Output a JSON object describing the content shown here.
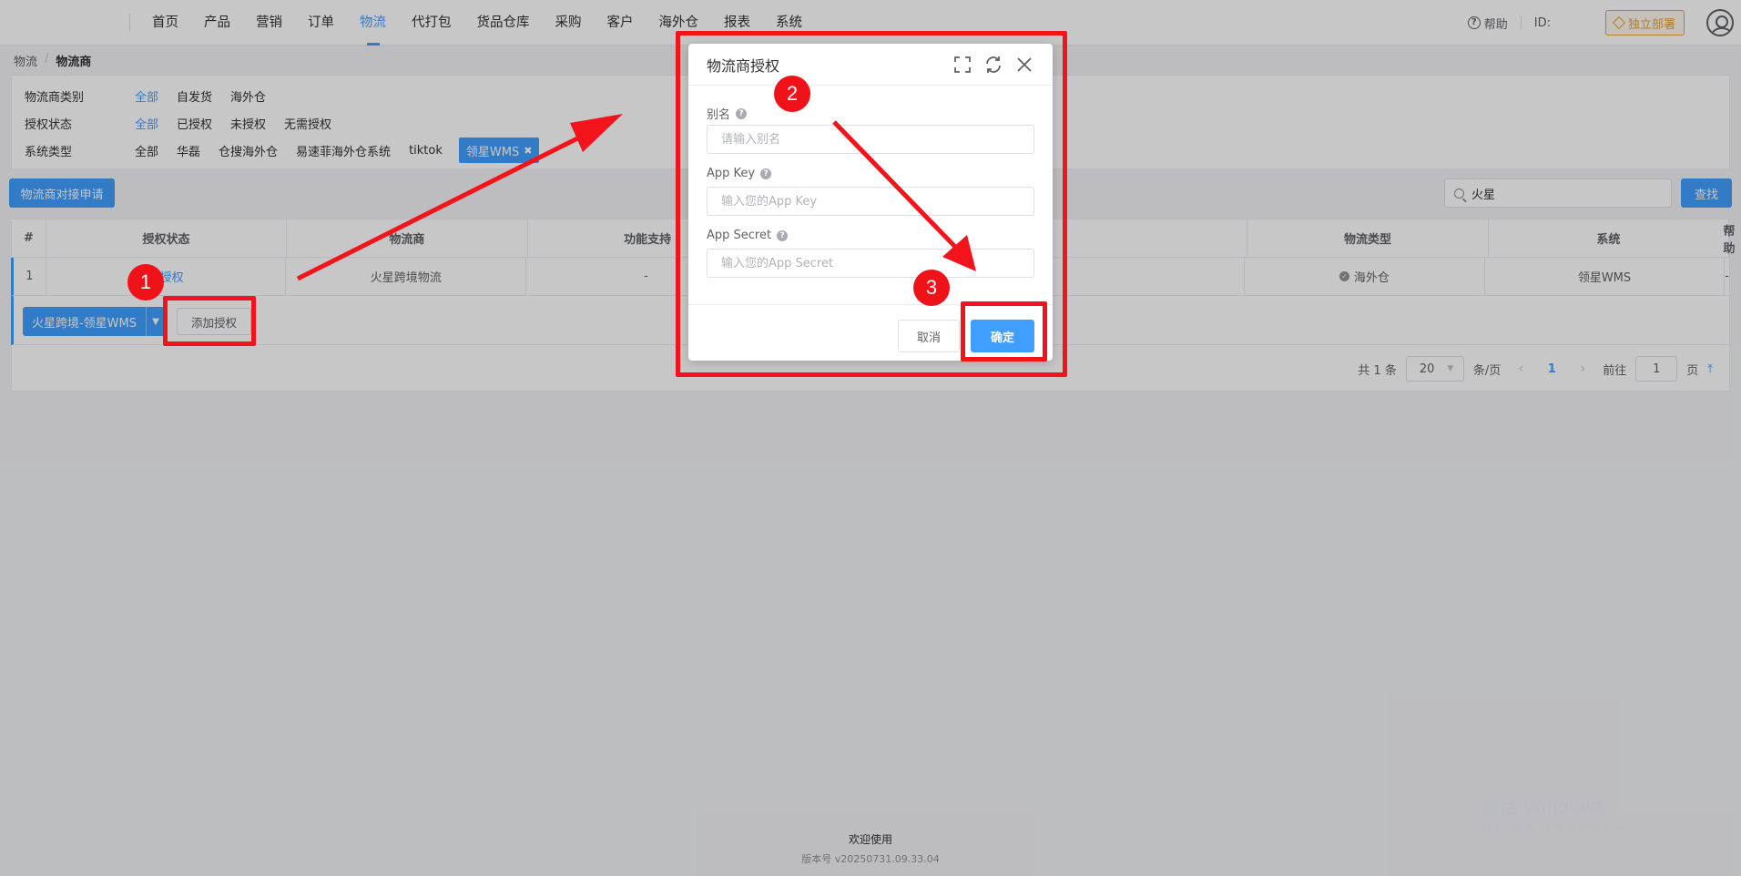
{
  "nav": {
    "items": [
      "首页",
      "产品",
      "营销",
      "订单",
      "物流",
      "代打包",
      "货品仓库",
      "采购",
      "客户",
      "海外仓",
      "报表",
      "系统"
    ],
    "help": "帮助",
    "id_label": "ID:",
    "deploy": "独立部署"
  },
  "breadcrumb": {
    "root": "物流",
    "current": "物流商"
  },
  "filters": {
    "category": {
      "label": "物流商类别",
      "options": [
        "全部",
        "自发货",
        "海外仓"
      ]
    },
    "auth_status": {
      "label": "授权状态",
      "options": [
        "全部",
        "已授权",
        "未授权",
        "无需授权"
      ]
    },
    "system_type": {
      "label": "系统类型",
      "options": [
        "全部",
        "华磊",
        "仓搜海外仓",
        "易速菲海外仓系统",
        "tiktok"
      ],
      "selected_tag": "领星WMS"
    }
  },
  "toolbar": {
    "apply_button": "物流商对接申请",
    "search_value": "火星",
    "find_button": "查找"
  },
  "table": {
    "headers": [
      "#",
      "授权状态",
      "物流商",
      "功能支持",
      "物流类型",
      "系统",
      "帮助"
    ],
    "row": {
      "index": "1",
      "status": "已授权",
      "carrier": "火星跨境物流",
      "features": "-",
      "type": "海外仓",
      "system": "领星WMS",
      "help": "-"
    },
    "split_button": "火星跨境-领星WMS",
    "add_button": "添加授权"
  },
  "pagination": {
    "total": "共 1 条",
    "page_size": "20",
    "per_page": "条/页",
    "current": "1",
    "goto_label": "前往",
    "goto_value": "1",
    "page_unit": "页"
  },
  "dialog": {
    "title": "物流商授权",
    "alias_label": "别名",
    "alias_placeholder": "请输入别名",
    "appkey_label": "App Key",
    "appkey_placeholder": "输入您的App Key",
    "secret_label": "App Secret",
    "secret_placeholder": "输入您的App Secret",
    "cancel": "取消",
    "confirm": "确定"
  },
  "annotations": {
    "badge1": "1",
    "badge2": "2",
    "badge3": "3"
  },
  "footer": {
    "title": "欢迎使用",
    "version": "版本号 v20250731.09.33.04"
  },
  "watermark": {
    "title": "激活 Windows",
    "subtitle": "转到\"设置\"以激活 Windows。"
  },
  "colors": {
    "primary": "#409eff",
    "annotation_red": "#f2141a",
    "deploy_orange": "#e6a23c"
  }
}
